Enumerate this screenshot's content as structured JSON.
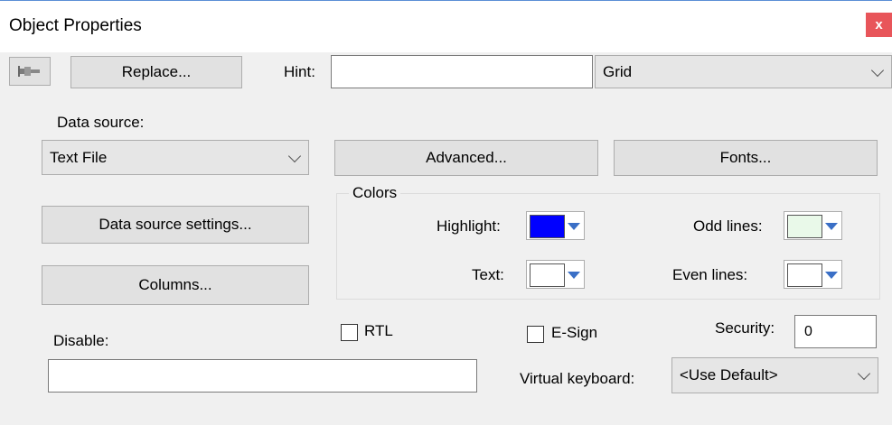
{
  "window": {
    "title": "Object Properties",
    "close_glyph": "x"
  },
  "toolbar": {
    "pin_icon": "pin-icon",
    "replace_label": "Replace...",
    "hint_label": "Hint:",
    "hint_value": "",
    "type_value": "Grid"
  },
  "data_source": {
    "label": "Data source:",
    "value": "Text File",
    "advanced_label": "Advanced...",
    "fonts_label": "Fonts...",
    "settings_label": "Data source settings...",
    "columns_label": "Columns..."
  },
  "colors": {
    "caption": "Colors",
    "highlight_label": "Highlight:",
    "highlight_color": "#0000ff",
    "text_label": "Text:",
    "text_color": "#ffffff",
    "odd_label": "Odd lines:",
    "odd_color": "#e9f9e9",
    "even_label": "Even lines:",
    "even_color": "#ffffff"
  },
  "bottom": {
    "disable_label": "Disable:",
    "disable_value": "",
    "rtl_label": "RTL",
    "esign_label": "E-Sign",
    "security_label": "Security:",
    "security_value": "0",
    "vk_label": "Virtual keyboard:",
    "vk_value": "<Use Default>"
  }
}
